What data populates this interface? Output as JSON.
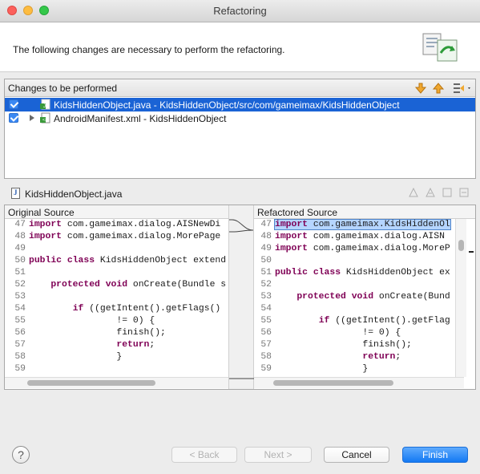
{
  "window": {
    "title": "Refactoring"
  },
  "header": {
    "message": "The following changes are necessary to perform the refactoring.",
    "icon": "refactor-wizard-icon"
  },
  "changes": {
    "title": "Changes to be performed",
    "toolbar_icons": [
      "next-change-icon",
      "previous-change-icon",
      "filter-changes-icon"
    ],
    "items": [
      {
        "label": "KidsHiddenObject.java - KidsHiddenObject/src/com/gameimax/KidsHiddenObject",
        "checked": true,
        "selected": true,
        "icon": "java-file-change-icon"
      },
      {
        "label": "AndroidManifest.xml - KidsHiddenObject",
        "checked": true,
        "selected": false,
        "icon": "xml-file-change-icon"
      }
    ]
  },
  "file_bar": {
    "label": "KidsHiddenObject.java"
  },
  "original": {
    "title": "Original Source",
    "lines": [
      {
        "n": "47",
        "kw": "import",
        "rest": " com.gameimax.dialog.AISNewDi"
      },
      {
        "n": "48",
        "kw": "import",
        "rest": " com.gameimax.dialog.MorePage"
      },
      {
        "n": "49",
        "kw": "",
        "rest": ""
      },
      {
        "n": "50",
        "kw": "public class",
        "rest": " KidsHiddenObject extend"
      },
      {
        "n": "51",
        "kw": "",
        "rest": ""
      },
      {
        "n": "52",
        "kw": "",
        "rest": "    ",
        "kw2": "protected void",
        "rest2": " onCreate(Bundle s"
      },
      {
        "n": "53",
        "kw": "",
        "rest": ""
      },
      {
        "n": "54",
        "kw": "",
        "rest": "        ",
        "kw2": "if",
        "rest2": " ((getIntent().getFlags()"
      },
      {
        "n": "55",
        "kw": "",
        "rest": "                != 0) {"
      },
      {
        "n": "56",
        "kw": "",
        "rest": "                finish();"
      },
      {
        "n": "57",
        "kw": "",
        "rest": "                ",
        "kw2": "return",
        "rest2": ";"
      },
      {
        "n": "58",
        "kw": "",
        "rest": "                }"
      },
      {
        "n": "59",
        "kw": "",
        "rest": ""
      }
    ]
  },
  "refactored": {
    "title": "Refactored Source",
    "lines": [
      {
        "n": "47",
        "kw": "import",
        "rest": " com.gameimax.KidsHiddenOl",
        "selected": true
      },
      {
        "n": "48",
        "kw": "import",
        "rest": " com.gameimax.dialog.AISN"
      },
      {
        "n": "49",
        "kw": "import",
        "rest": " com.gameimax.dialog.MoreP"
      },
      {
        "n": "50",
        "kw": "",
        "rest": ""
      },
      {
        "n": "51",
        "kw": "public class",
        "rest": " KidsHiddenObject ex"
      },
      {
        "n": "52",
        "kw": "",
        "rest": ""
      },
      {
        "n": "53",
        "kw": "",
        "rest": "    ",
        "kw2": "protected void",
        "rest2": " onCreate(Bund"
      },
      {
        "n": "54",
        "kw": "",
        "rest": ""
      },
      {
        "n": "55",
        "kw": "",
        "rest": "        ",
        "kw2": "if",
        "rest2": " ((getIntent().getFlag"
      },
      {
        "n": "56",
        "kw": "",
        "rest": "                != 0) {"
      },
      {
        "n": "57",
        "kw": "",
        "rest": "                finish();"
      },
      {
        "n": "58",
        "kw": "",
        "rest": "                ",
        "kw2": "return",
        "rest2": ";"
      },
      {
        "n": "59",
        "kw": "",
        "rest": "                }"
      }
    ]
  },
  "buttons": {
    "help": "?",
    "back": "< Back",
    "next": "Next >",
    "cancel": "Cancel",
    "finish": "Finish"
  },
  "colors": {
    "selection": "#1a63d5",
    "keyword": "#7f0055",
    "primary_button": "#1479f3"
  }
}
